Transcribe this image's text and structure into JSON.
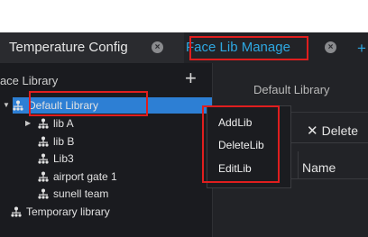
{
  "tabs": [
    {
      "label": "Temperature Config",
      "active": false
    },
    {
      "label": "Face Lib Manage",
      "active": true
    }
  ],
  "left_panel": {
    "title": "Face Library",
    "add_icon": "plus-icon",
    "tree": [
      {
        "label": "Default Library",
        "selected": true,
        "expanded": true
      },
      {
        "label": "lib A",
        "has_children": true
      },
      {
        "label": "lib B"
      },
      {
        "label": "Lib3"
      },
      {
        "label": "airport gate 1"
      },
      {
        "label": "sunell team"
      },
      {
        "label": "Temporary library"
      }
    ]
  },
  "right_panel": {
    "title": "Default Library",
    "delete_label": "Delete",
    "column_name": "Name"
  },
  "context_menu": {
    "items": [
      "AddLib",
      "DeleteLib",
      "EditLib"
    ]
  },
  "colors": {
    "accent": "#2ea7e0",
    "selection": "#2d7fd4",
    "highlight_box": "#e01e1e",
    "background": "#1c1d21"
  }
}
